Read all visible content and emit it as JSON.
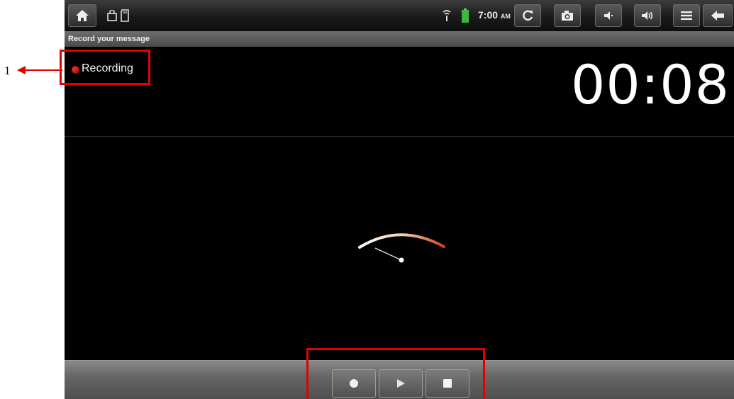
{
  "callout": {
    "number": "1"
  },
  "statusbar": {
    "time": "7:00",
    "ampm": "AM",
    "icons": [
      "home-icon",
      "bag-icon",
      "sd-card-icon",
      "signal-icon",
      "battery-icon",
      "refresh-icon",
      "camera-icon",
      "volume-down-icon",
      "volume-up-icon",
      "menu-icon",
      "back-icon"
    ]
  },
  "title": "Record your message",
  "recorder": {
    "state_label": "Recording",
    "elapsed": "00:08"
  },
  "controls": {
    "buttons": [
      "record-button",
      "play-button",
      "stop-button"
    ]
  },
  "colors": {
    "highlight_box": "#e30000",
    "recording_dot": "#cc2222",
    "screen_bg": "#000000"
  }
}
